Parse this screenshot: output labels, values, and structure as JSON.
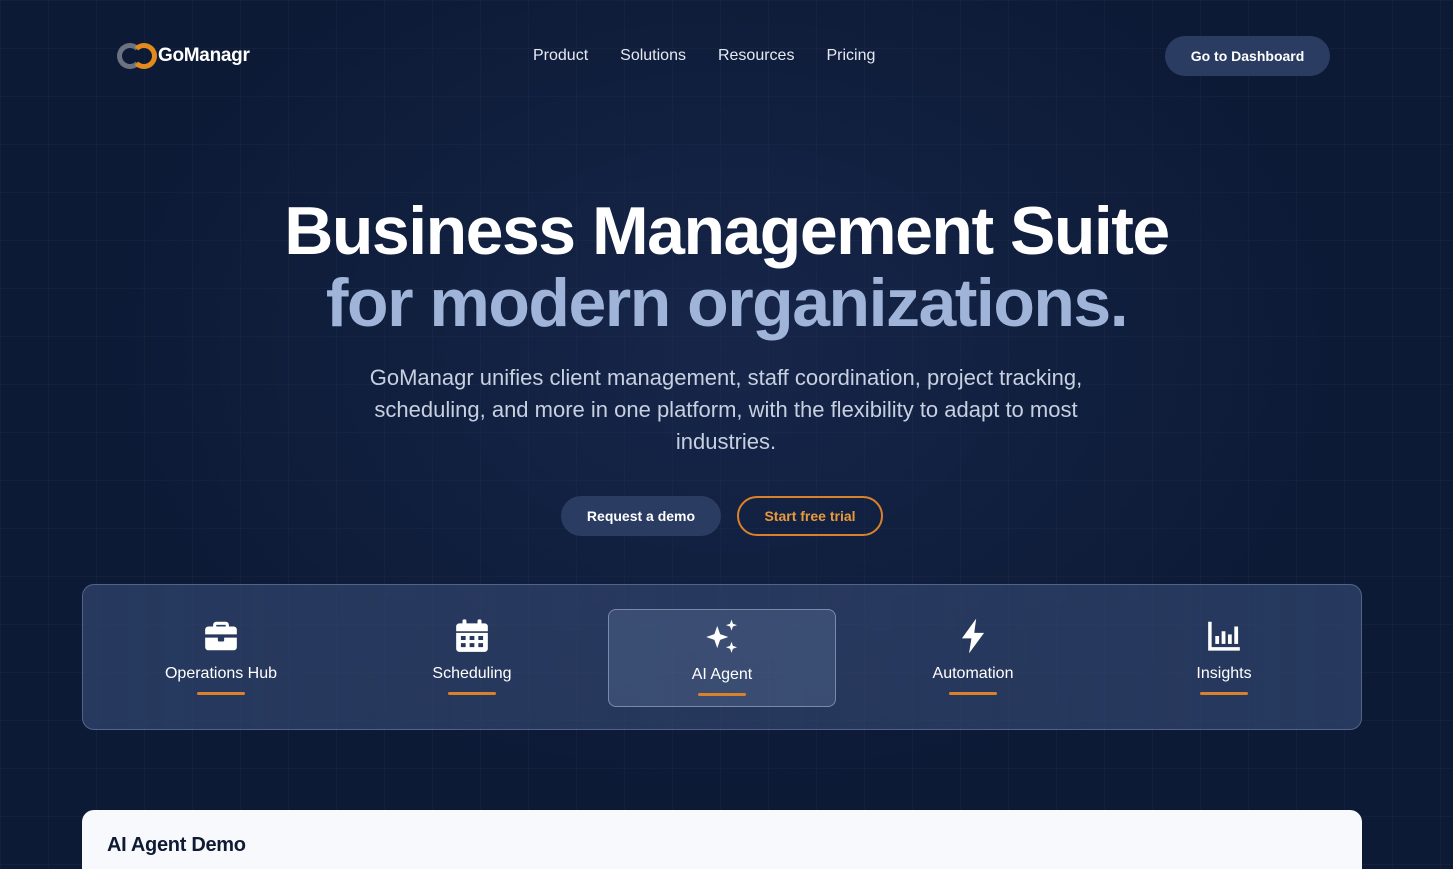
{
  "brand": {
    "name": "GoManagr",
    "accent": "#d9822b"
  },
  "nav": {
    "items": [
      "Product",
      "Solutions",
      "Resources",
      "Pricing"
    ]
  },
  "header": {
    "dashboard_label": "Go to Dashboard"
  },
  "hero": {
    "title_line1": "Business Management Suite",
    "title_line2": "for modern organizations.",
    "subtitle": "GoManagr unifies client management, staff coordination, project tracking, scheduling, and more in one platform, with the flexibility to adapt to most industries.",
    "demo_label": "Request a demo",
    "trial_label": "Start free trial"
  },
  "tabs": {
    "items": [
      {
        "label": "Operations Hub",
        "icon": "briefcase-icon"
      },
      {
        "label": "Scheduling",
        "icon": "calendar-icon"
      },
      {
        "label": "AI Agent",
        "icon": "sparkles-icon",
        "active": true
      },
      {
        "label": "Automation",
        "icon": "lightning-icon"
      },
      {
        "label": "Insights",
        "icon": "bar-chart-icon"
      }
    ]
  },
  "demo": {
    "title": "AI Agent Demo"
  },
  "colors": {
    "background": "#0d1a36",
    "title_secondary": "#9fb4d8",
    "button": "#2a3c62"
  }
}
